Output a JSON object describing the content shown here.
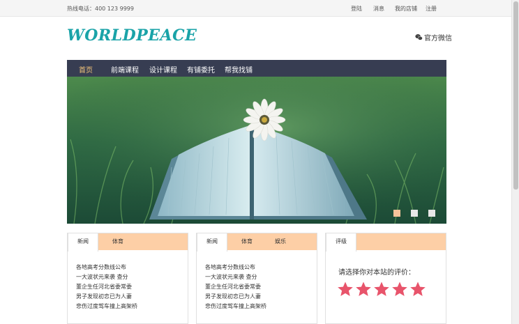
{
  "topbar": {
    "hotline": "热线电话：400 123 9999",
    "links": [
      "登陆",
      "消息",
      "我的店铺",
      "注册"
    ]
  },
  "header": {
    "logo": "WORLDPEACE",
    "wechat_label": "官方微信",
    "wechat_icon": "wechat-icon"
  },
  "nav": {
    "items": [
      "首页",
      "前端课程",
      "设计课程",
      "有铺委托",
      "帮我找铺"
    ],
    "active_index": 0
  },
  "banner": {
    "image": "open book with white daisy on grass",
    "slides": 3,
    "active_slide": 0
  },
  "panels": [
    {
      "tabs": [
        "新闻",
        "体育"
      ],
      "active_tab": 0,
      "items": [
        "各地高考分数线公布",
        "一大波状元来袭 查分",
        "董企生任河北省委常委",
        "男子发现初恋已为人妻",
        "悲伤过度驾车撞上高架桥"
      ]
    },
    {
      "tabs": [
        "新闻",
        "体育",
        "娱乐"
      ],
      "active_tab": 0,
      "items": [
        "各地高考分数线公布",
        "一大波状元来袭 查分",
        "董企生任河北省委常委",
        "男子发现初恋已为人妻",
        "悲伤过度驾车撞上高架桥"
      ]
    },
    {
      "tabs": [
        "评级"
      ],
      "active_tab": 0,
      "prompt": "请选择你对本站的评价：",
      "rating": 5,
      "rating_max": 5
    }
  ],
  "colors": {
    "nav_bg": "#373d52",
    "nav_active": "#f4c57a",
    "logo": "#1aa3a8",
    "tabbar": "#fdcfa6",
    "star": "#e8546b",
    "dot_active": "#f6c39a",
    "dot": "#e8e8e8"
  }
}
